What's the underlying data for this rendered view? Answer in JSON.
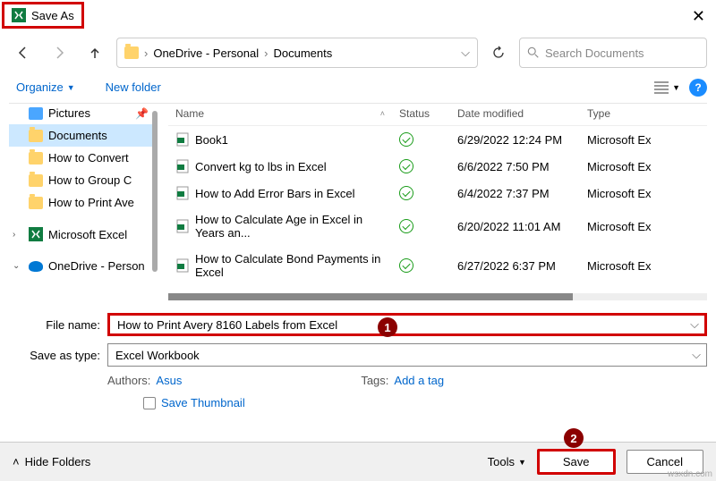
{
  "title": "Save As",
  "breadcrumb": {
    "root": "OneDrive - Personal",
    "folder": "Documents"
  },
  "search_placeholder": "Search Documents",
  "toolbar": {
    "organize": "Organize",
    "newfolder": "New folder"
  },
  "columns": {
    "name": "Name",
    "status": "Status",
    "date": "Date modified",
    "type": "Type"
  },
  "sidebar": {
    "items": [
      {
        "label": "Pictures",
        "icon": "pic"
      },
      {
        "label": "Documents",
        "icon": "folder",
        "active": true
      },
      {
        "label": "How to Convert",
        "icon": "folder"
      },
      {
        "label": "How to Group C",
        "icon": "folder"
      },
      {
        "label": "How to Print Ave",
        "icon": "folder"
      },
      {
        "label": "Microsoft Excel",
        "icon": "excel"
      },
      {
        "label": "OneDrive - Person",
        "icon": "onedrive",
        "expanded": true
      }
    ]
  },
  "files": [
    {
      "name": "Book1",
      "date": "6/29/2022 12:24 PM",
      "type": "Microsoft Ex"
    },
    {
      "name": "Convert kg to lbs in Excel",
      "date": "6/6/2022 7:50 PM",
      "type": "Microsoft Ex"
    },
    {
      "name": "How to Add Error Bars in Excel",
      "date": "6/4/2022 7:37 PM",
      "type": "Microsoft Ex"
    },
    {
      "name": "How to Calculate Age in Excel in Years an...",
      "date": "6/20/2022 11:01 AM",
      "type": "Microsoft Ex"
    },
    {
      "name": "How to Calculate Bond Payments in Excel",
      "date": "6/27/2022 6:37 PM",
      "type": "Microsoft Ex"
    }
  ],
  "form": {
    "filename_label": "File name:",
    "filename_value": "How to Print Avery 8160 Labels from Excel",
    "saveastype_label": "Save as type:",
    "saveastype_value": "Excel Workbook",
    "authors_label": "Authors:",
    "authors_value": "Asus",
    "tags_label": "Tags:",
    "tags_value": "Add a tag",
    "thumbnail": "Save Thumbnail"
  },
  "footer": {
    "hidefolders": "Hide Folders",
    "tools": "Tools",
    "save": "Save",
    "cancel": "Cancel"
  },
  "badges": {
    "b1": "1",
    "b2": "2"
  },
  "watermark": "wsxdn.com"
}
